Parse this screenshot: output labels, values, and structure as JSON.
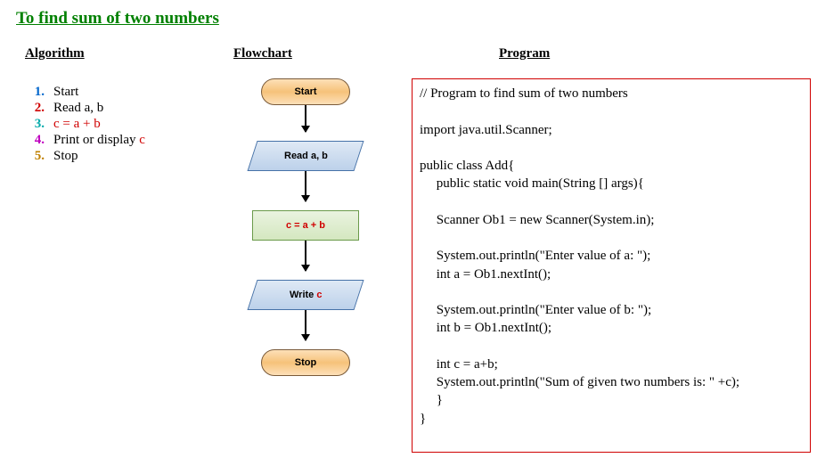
{
  "title": "To find sum of two numbers",
  "headers": {
    "algorithm": "Algorithm",
    "flowchart": "Flowchart",
    "program": "Program"
  },
  "algorithm": {
    "items": [
      {
        "num": "1.",
        "numClass": "n1",
        "text_plain": "Start",
        "text_red": ""
      },
      {
        "num": "2.",
        "numClass": "n2",
        "text_plain": "Read a, b",
        "text_red": ""
      },
      {
        "num": "3.",
        "numClass": "n3",
        "text_plain": "",
        "text_red": "c = a + b"
      },
      {
        "num": "4.",
        "numClass": "n4",
        "text_plain": "Print or display ",
        "text_red": "c"
      },
      {
        "num": "5.",
        "numClass": "n5",
        "text_plain": "Stop",
        "text_red": ""
      }
    ]
  },
  "flowchart": {
    "start": "Start",
    "read": "Read a, b",
    "process": "c = a + b",
    "write_prefix": "Write ",
    "write_var": "c",
    "stop": "Stop"
  },
  "program": {
    "code": "// Program to find sum of two numbers\n\nimport java.util.Scanner;\n\npublic class Add{\n     public static void main(String [] args){\n\n     Scanner Ob1 = new Scanner(System.in);\n\n     System.out.println(\"Enter value of a: \");\n     int a = Ob1.nextInt();\n\n     System.out.println(\"Enter value of b: \");\n     int b = Ob1.nextInt();\n\n     int c = a+b;\n     System.out.println(\"Sum of given two numbers is: \" +c);\n     }\n}"
  }
}
